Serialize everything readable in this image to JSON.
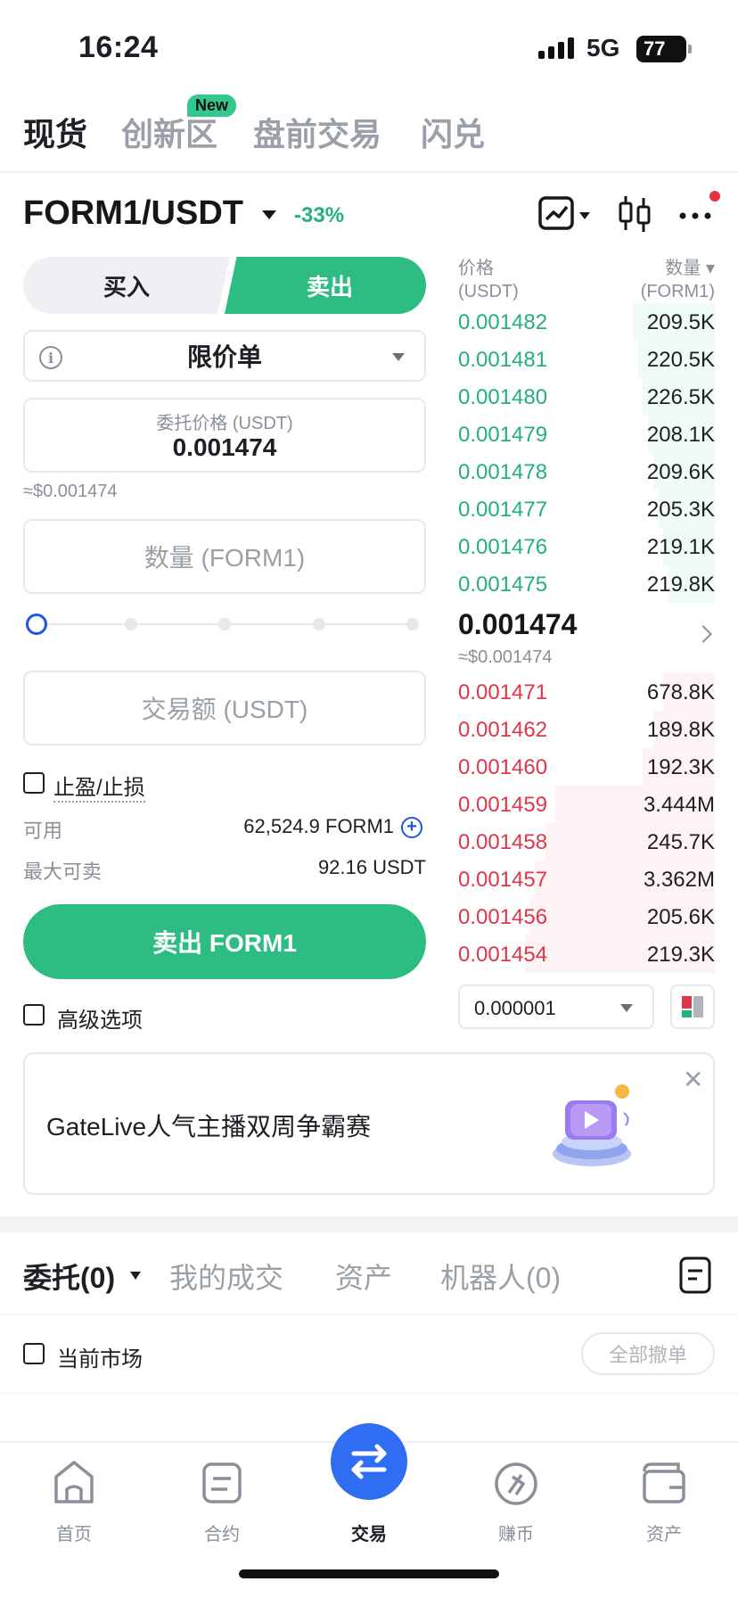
{
  "status_bar": {
    "time": "16:24",
    "network": "5G",
    "battery": "77"
  },
  "top_tabs": [
    {
      "label": "现货"
    },
    {
      "label": "创新区",
      "badge": "New"
    },
    {
      "label": "盘前交易"
    },
    {
      "label": "闪兑"
    }
  ],
  "pair": {
    "name": "FORM1/USDT",
    "change": "-33%"
  },
  "trade_form": {
    "buy_label": "买入",
    "sell_label": "卖出",
    "order_type": "限价单",
    "price_label": "委托价格 (USDT)",
    "price_value": "0.001474",
    "price_approx": "≈$0.001474",
    "qty_placeholder": "数量 (FORM1)",
    "amount_placeholder": "交易额 (USDT)",
    "slider_level": 0,
    "tpsl_label": "止盈/止损",
    "available_label": "可用",
    "available_value": "62,524.9 FORM1",
    "max_sell_label": "最大可卖",
    "max_sell_value": "92.16 USDT",
    "submit_label": "卖出 FORM1",
    "advanced_label": "高级选项"
  },
  "order_book": {
    "price_header": "价格",
    "price_unit": "(USDT)",
    "qty_header": "数量",
    "qty_unit": "(FORM1)",
    "asks": [
      {
        "price": "0.001482",
        "qty": "209.5K",
        "depth": 0.32
      },
      {
        "price": "0.001481",
        "qty": "220.5K",
        "depth": 0.3
      },
      {
        "price": "0.001480",
        "qty": "226.5K",
        "depth": 0.28
      },
      {
        "price": "0.001479",
        "qty": "208.1K",
        "depth": 0.26
      },
      {
        "price": "0.001478",
        "qty": "209.6K",
        "depth": 0.24
      },
      {
        "price": "0.001477",
        "qty": "205.3K",
        "depth": 0.22
      },
      {
        "price": "0.001476",
        "qty": "219.1K",
        "depth": 0.2
      },
      {
        "price": "0.001475",
        "qty": "219.8K",
        "depth": 0.18
      }
    ],
    "mid_price": "0.001474",
    "mid_approx": "≈$0.001474",
    "bids": [
      {
        "price": "0.001471",
        "qty": "678.8K",
        "depth": 0.2
      },
      {
        "price": "0.001462",
        "qty": "189.8K",
        "depth": 0.24
      },
      {
        "price": "0.001460",
        "qty": "192.3K",
        "depth": 0.28
      },
      {
        "price": "0.001459",
        "qty": "3.444M",
        "depth": 0.62
      },
      {
        "price": "0.001458",
        "qty": "245.7K",
        "depth": 0.66
      },
      {
        "price": "0.001457",
        "qty": "3.362M",
        "depth": 0.7
      },
      {
        "price": "0.001456",
        "qty": "205.6K",
        "depth": 0.72
      },
      {
        "price": "0.001454",
        "qty": "219.3K",
        "depth": 0.74
      }
    ],
    "precision": "0.000001"
  },
  "banner": {
    "text": "GateLive人气主播双周争霸赛"
  },
  "orders": {
    "tabs": [
      {
        "label": "委托(0)"
      },
      {
        "label": "我的成交"
      },
      {
        "label": "资产"
      },
      {
        "label": "机器人(0)"
      }
    ],
    "current_market_label": "当前市场",
    "cancel_all_label": "全部撤单"
  },
  "bottom_nav": [
    {
      "label": "首页",
      "icon": "home-icon"
    },
    {
      "label": "合约",
      "icon": "futures-icon"
    },
    {
      "label": "交易",
      "icon": "swap-icon"
    },
    {
      "label": "赚币",
      "icon": "earn-icon"
    },
    {
      "label": "资产",
      "icon": "wallet-icon"
    }
  ],
  "colors": {
    "green": "#2dbd82",
    "red": "#e0364a",
    "blue": "#2f6ef2"
  }
}
